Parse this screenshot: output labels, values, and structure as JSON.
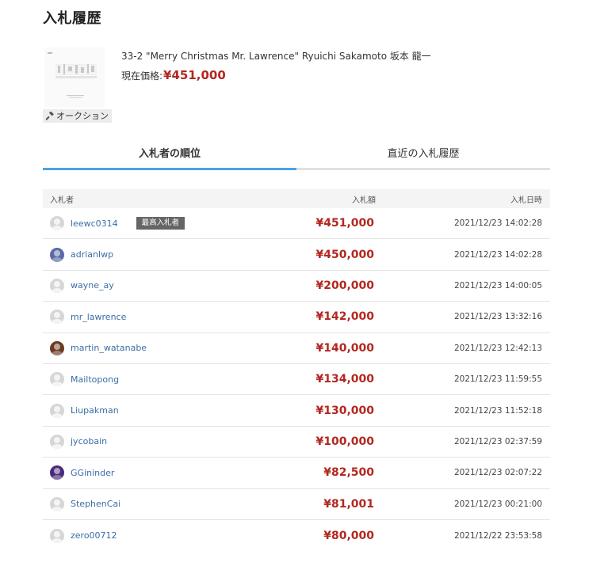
{
  "page": {
    "title": "入札履歴"
  },
  "item": {
    "title": "33-2 \"Merry Christmas Mr. Lawrence\" Ryuichi Sakamoto 坂本 龍一",
    "price_label": "現在価格:",
    "price": "¥451,000",
    "auction_label": "オークション",
    "thumb_icon": "sheet-music-thumbnail",
    "auction_icon": "gavel-icon"
  },
  "tabs": [
    {
      "label": "入札者の順位",
      "active": true
    },
    {
      "label": "直近の入札履歴",
      "active": false
    }
  ],
  "table": {
    "headers": {
      "bidder": "入札者",
      "amount": "入札額",
      "time": "入札日時"
    },
    "top_badge": "最高入札者",
    "rows": [
      {
        "bidder": "leewc0314",
        "amount": "¥451,000",
        "time": "2021/12/23 14:02:28",
        "avatar": "default",
        "top": true
      },
      {
        "bidder": "adrianlwp",
        "amount": "¥450,000",
        "time": "2021/12/23 14:02:28",
        "avatar": "photo",
        "avatar_color": "#5a6aa8"
      },
      {
        "bidder": "wayne_ay",
        "amount": "¥200,000",
        "time": "2021/12/23 14:00:05",
        "avatar": "default"
      },
      {
        "bidder": "mr_lawrence",
        "amount": "¥142,000",
        "time": "2021/12/23 13:32:16",
        "avatar": "default"
      },
      {
        "bidder": "martin_watanabe",
        "amount": "¥140,000",
        "time": "2021/12/23 12:42:13",
        "avatar": "photo",
        "avatar_color": "#6b3a22"
      },
      {
        "bidder": "Mailtopong",
        "amount": "¥134,000",
        "time": "2021/12/23 11:59:55",
        "avatar": "default"
      },
      {
        "bidder": "Liupakman",
        "amount": "¥130,000",
        "time": "2021/12/23 11:52:18",
        "avatar": "default"
      },
      {
        "bidder": "jycobain",
        "amount": "¥100,000",
        "time": "2021/12/23 02:37:59",
        "avatar": "default"
      },
      {
        "bidder": "GGininder",
        "amount": "¥82,500",
        "time": "2021/12/23 02:07:22",
        "avatar": "photo",
        "avatar_color": "#4a2a7a"
      },
      {
        "bidder": "StephenCai",
        "amount": "¥81,001",
        "time": "2021/12/23 00:21:00",
        "avatar": "default"
      },
      {
        "bidder": "zero00712",
        "amount": "¥80,000",
        "time": "2021/12/22 23:53:58",
        "avatar": "default"
      }
    ]
  },
  "colors": {
    "accent_tab": "#4ba3e3",
    "price": "#b3271f",
    "link": "#3a6ea5",
    "badge": "#666666"
  }
}
